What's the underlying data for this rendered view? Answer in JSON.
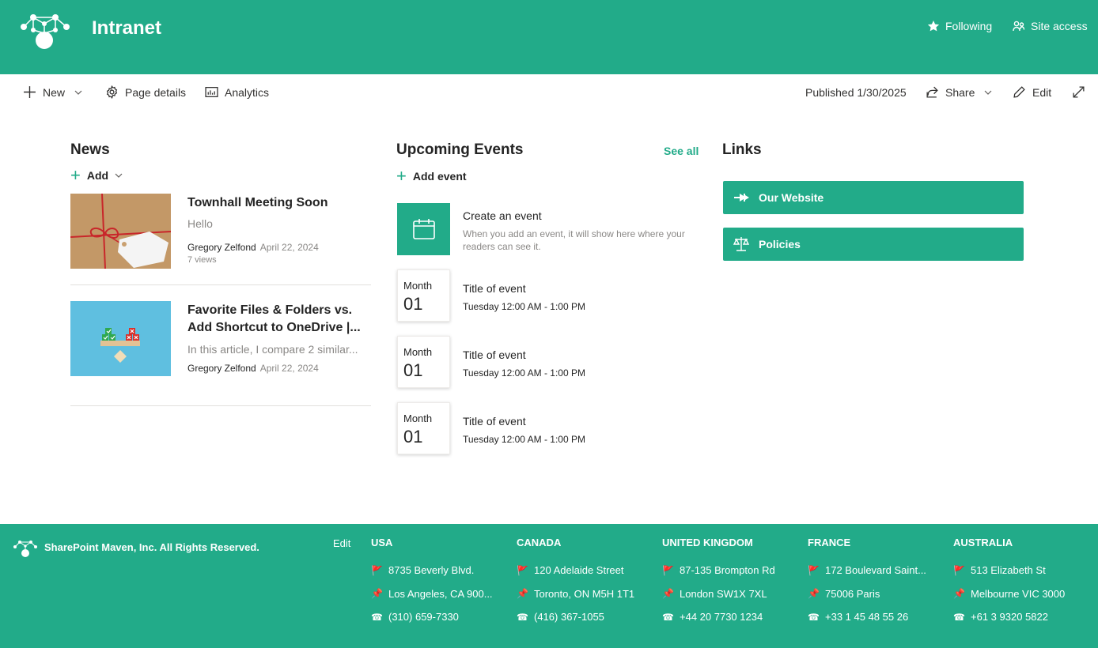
{
  "header": {
    "site_title": "Intranet",
    "following_label": "Following",
    "site_access_label": "Site access"
  },
  "commandbar": {
    "new_label": "New",
    "page_details_label": "Page details",
    "analytics_label": "Analytics",
    "published_label": "Published 1/30/2025",
    "share_label": "Share",
    "edit_label": "Edit"
  },
  "news": {
    "title": "News",
    "add_label": "Add",
    "items": [
      {
        "title": "Townhall Meeting Soon",
        "description": "Hello",
        "author": "Gregory Zelfond",
        "date": "April 22, 2024",
        "views": "7 views",
        "thumb": "gift-package"
      },
      {
        "title": "Favorite Files & Folders vs. Add Shortcut to OneDrive |...",
        "description": "In this article, I compare 2 similar...",
        "author": "Gregory Zelfond",
        "date": "April 22, 2024",
        "thumb": "balance-blocks"
      }
    ]
  },
  "events": {
    "title": "Upcoming Events",
    "see_all_label": "See all",
    "add_label": "Add event",
    "create_title": "Create an event",
    "create_desc": "When you add an event, it will show here where your readers can see it.",
    "items": [
      {
        "month": "Month",
        "day": "01",
        "title": "Title of event",
        "time": "Tuesday 12:00 AM - 1:00 PM"
      },
      {
        "month": "Month",
        "day": "01",
        "title": "Title of event",
        "time": "Tuesday 12:00 AM - 1:00 PM"
      },
      {
        "month": "Month",
        "day": "01",
        "title": "Title of event",
        "time": "Tuesday 12:00 AM - 1:00 PM"
      }
    ]
  },
  "links": {
    "title": "Links",
    "items": [
      {
        "label": "Our Website",
        "icon": "pin-icon"
      },
      {
        "label": "Policies",
        "icon": "scales-icon"
      }
    ]
  },
  "footer": {
    "copyright": "SharePoint Maven, Inc. All Rights Reserved.",
    "edit_label": "Edit",
    "countries": [
      {
        "name": "USA",
        "address": "8735 Beverly Blvd.",
        "city": "Los Angeles, CA 900...",
        "phone": "(310) 659-7330"
      },
      {
        "name": "CANADA",
        "address": "120 Adelaide Street",
        "city": "Toronto, ON M5H 1T1",
        "phone": "(416) 367-1055"
      },
      {
        "name": "UNITED KINGDOM",
        "address": "87-135 Brompton Rd",
        "city": "London SW1X 7XL",
        "phone": "+44 20 7730 1234"
      },
      {
        "name": "FRANCE",
        "address": "172 Boulevard Saint...",
        "city": "75006 Paris",
        "phone": "+33 1 45 48 55 26"
      },
      {
        "name": "AUSTRALIA",
        "address": "513 Elizabeth St",
        "city": "Melbourne VIC 3000",
        "phone": "+61 3 9320 5822"
      }
    ]
  },
  "colors": {
    "brand": "#22ab89",
    "text": "#242424",
    "muted": "#8a8886"
  }
}
